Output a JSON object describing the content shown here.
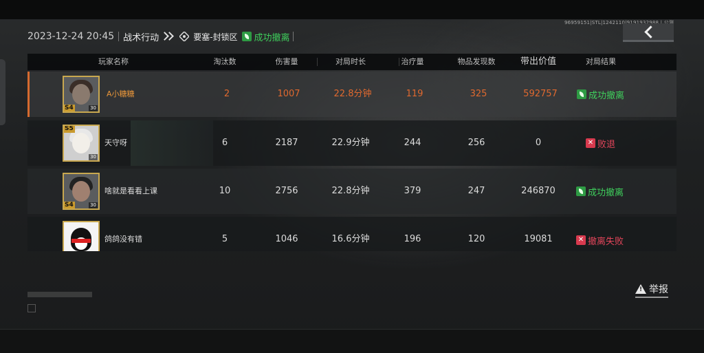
{
  "top_bar": {
    "uid_text": "96959151|STL|1242110|9191932988 | 公测"
  },
  "header": {
    "datetime": "2023-12-24 20:45",
    "mode": "战术行动",
    "map": "要塞-封锁区",
    "outcome": "成功撤离",
    "outcome_color": "#3fcf5c"
  },
  "back_button": {
    "icon": "arrow-left-icon"
  },
  "table": {
    "columns": [
      "玩家名称",
      "淘汰数",
      "伤害量",
      "对局时长",
      "治疗量",
      "物品发现数",
      "带出价值",
      "对局结果"
    ],
    "rows": [
      {
        "rank": "S4",
        "level": "30",
        "name": "A小糖糖",
        "kills": "2",
        "damage": "1007",
        "duration": "22.8分钟",
        "healing": "119",
        "items_found": "325",
        "value": "592757",
        "result": "成功撤离",
        "result_type": "success",
        "highlight": true
      },
      {
        "rank": "S5",
        "level": "30",
        "name": "天守呀",
        "kills": "6",
        "damage": "2187",
        "duration": "22.9分钟",
        "healing": "244",
        "items_found": "256",
        "value": "0",
        "result": "败退",
        "result_type": "fail"
      },
      {
        "rank": "S4",
        "level": "30",
        "name": "啥就是看看上课",
        "kills": "10",
        "damage": "2756",
        "duration": "22.8分钟",
        "healing": "379",
        "items_found": "247",
        "value": "246870",
        "result": "成功撤离",
        "result_type": "success"
      },
      {
        "rank": "",
        "level": "",
        "name": "鸽鸽没有错",
        "kills": "5",
        "damage": "1046",
        "duration": "16.6分钟",
        "healing": "196",
        "items_found": "120",
        "value": "19081",
        "result": "撤离失败",
        "result_type": "fail"
      }
    ]
  },
  "report": {
    "label": "举报",
    "icon": "warning-icon"
  },
  "colors": {
    "highlight_orange": "#e0692f",
    "success_green": "#3fcf5c",
    "fail_red": "#e2455a",
    "rank_gold": "#c99a2e"
  }
}
